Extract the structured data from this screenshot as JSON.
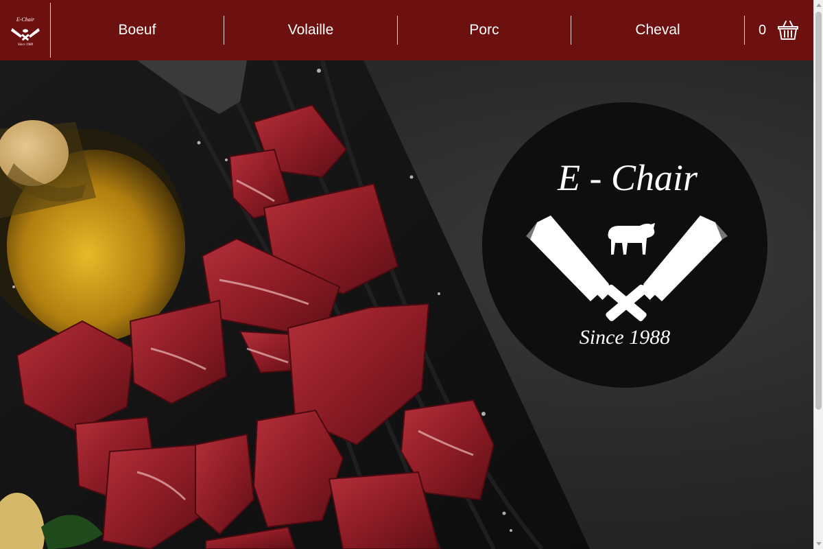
{
  "brand": {
    "name": "E - Chair",
    "tagline": "Since 1988",
    "mini_name": "E-Chair",
    "mini_tagline": "Since 1988"
  },
  "nav": {
    "items": [
      {
        "label": "Boeuf"
      },
      {
        "label": "Volaille"
      },
      {
        "label": "Porc"
      },
      {
        "label": "Cheval"
      }
    ],
    "cart_count": "0",
    "cart_icon": "basket-icon"
  },
  "colors": {
    "navbar": "#6c1010",
    "nav_text": "#ffffff",
    "emblem_bg": "#0e0e0e",
    "meat": "#9a1f28"
  }
}
